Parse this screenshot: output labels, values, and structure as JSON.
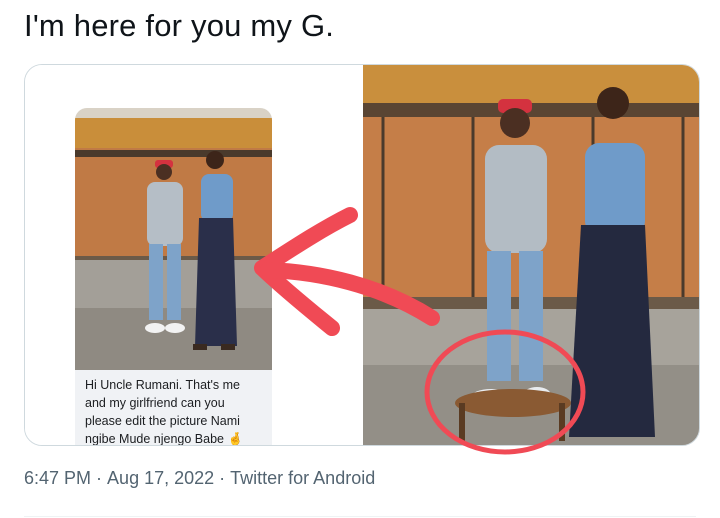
{
  "tweet": {
    "text": "I'm here for you my G."
  },
  "media": {
    "message_lines": [
      "Hi Uncle Rumani. That's me",
      "and my girlfriend can you",
      "please edit the picture Nami",
      "ngibe Mude njengo Babe 🤞"
    ]
  },
  "meta": {
    "time": "6:47 PM",
    "separator": " · ",
    "date": "Aug 17, 2022",
    "source": "Twitter for Android"
  },
  "colors": {
    "annotation_red": "#f04a55",
    "meta_gray": "#536471",
    "border": "#cfd9de"
  }
}
